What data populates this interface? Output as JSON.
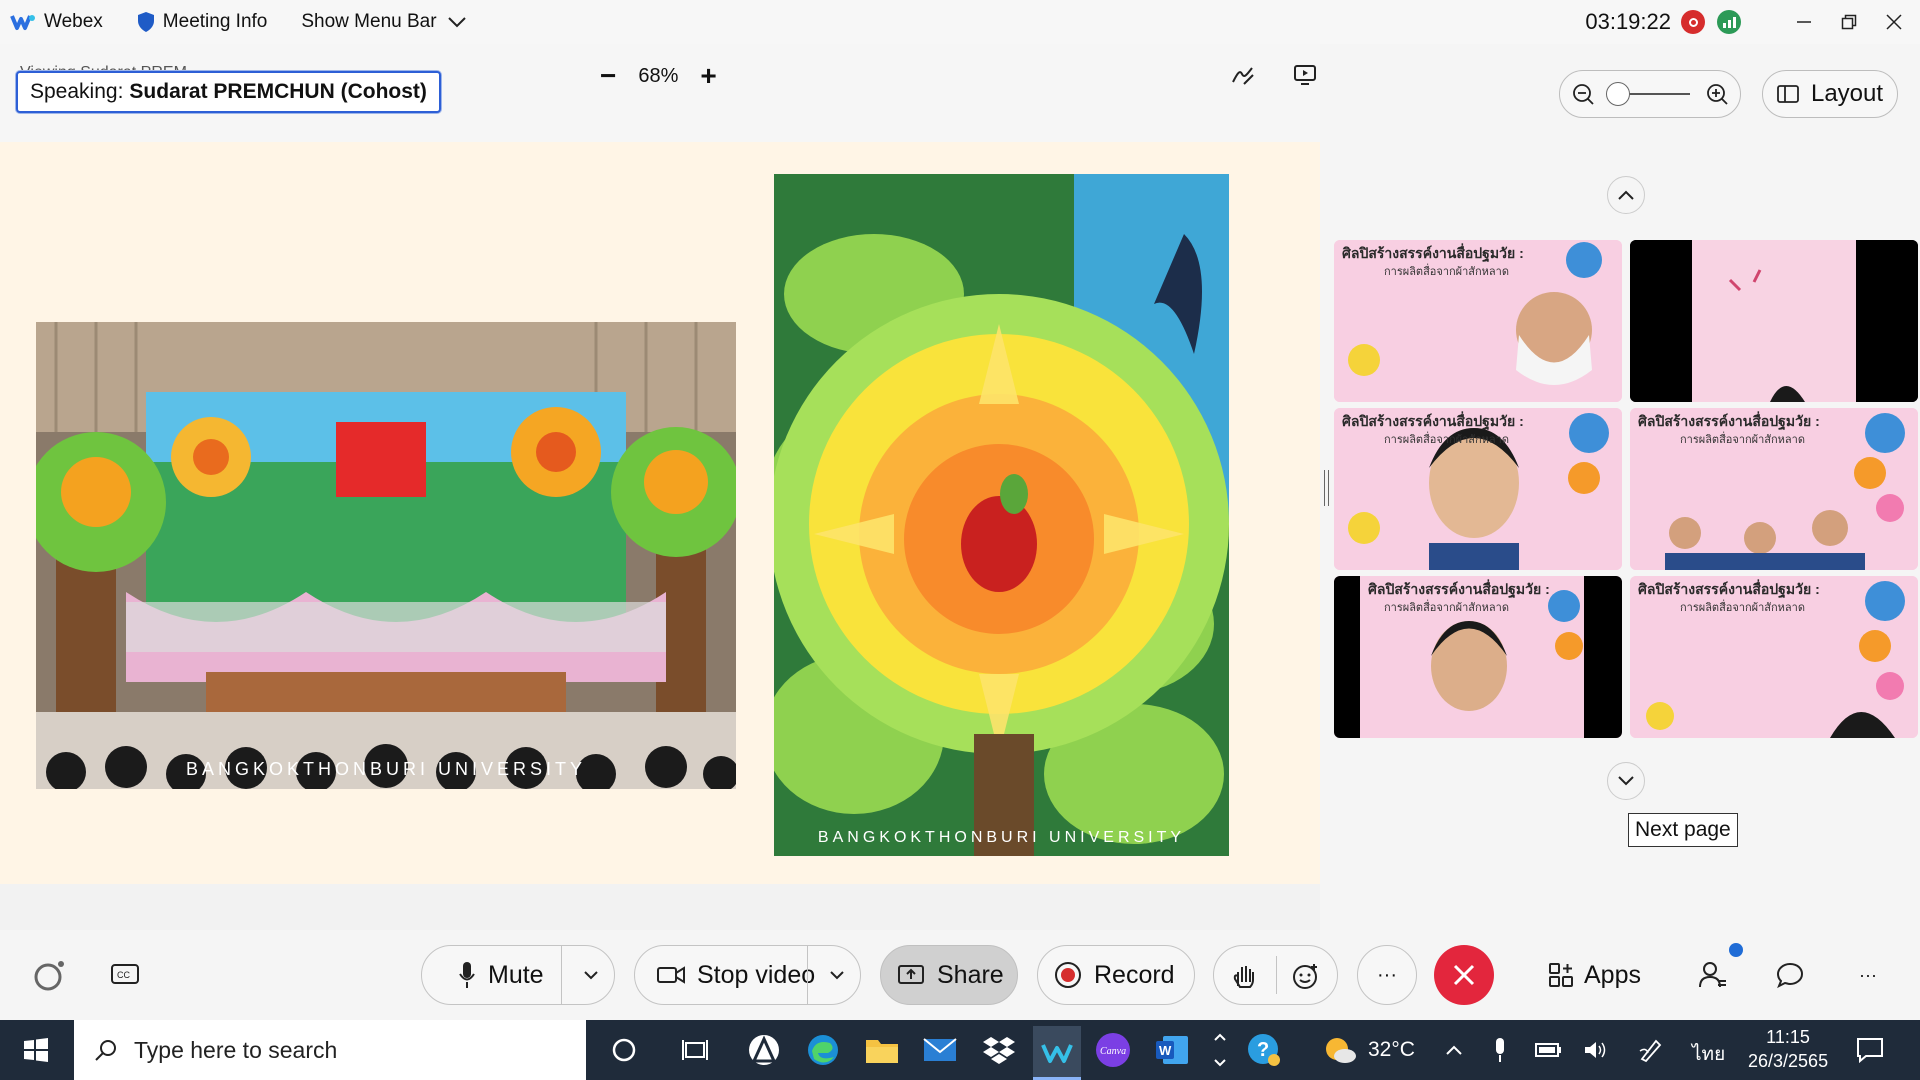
{
  "titlebar": {
    "app_name": "Webex",
    "meeting_info": "Meeting Info",
    "show_menu_bar": "Show Menu Bar",
    "timer": "03:19:22"
  },
  "stage": {
    "ghost_text": "Viewing Sudarat PREM",
    "speaking_label": "Speaking:",
    "speaking_name": "Sudarat PREMCHUN (Cohost)",
    "zoom_minus": "−",
    "zoom_level": "68%",
    "zoom_plus": "+",
    "watermark_left": "BANGKOKTHONBURI UNIVERSITY",
    "watermark_right": "BANGKOKTHONBURI UNIVERSITY"
  },
  "panel": {
    "layout_label": "Layout",
    "tooltip_next_page": "Next page",
    "tile_title": "ศิลปิสร้างสรรค์งานสื่อปฐมวัย :",
    "tile_subtitle": "การผลิตสื่อจากผ้าสักหลาด"
  },
  "controls": {
    "mute": "Mute",
    "stop_video": "Stop video",
    "share": "Share",
    "record": "Record",
    "apps": "Apps",
    "more": "···"
  },
  "taskbar": {
    "search_placeholder": "Type here to search",
    "temperature": "32°C",
    "language": "ไทย",
    "time": "11:15",
    "date": "26/3/2565"
  },
  "colors": {
    "accent_blue": "#2d5fd6",
    "end_call_red": "#e3263d",
    "record_red": "#d62d2d",
    "taskbar_bg": "#1f2b3a"
  }
}
